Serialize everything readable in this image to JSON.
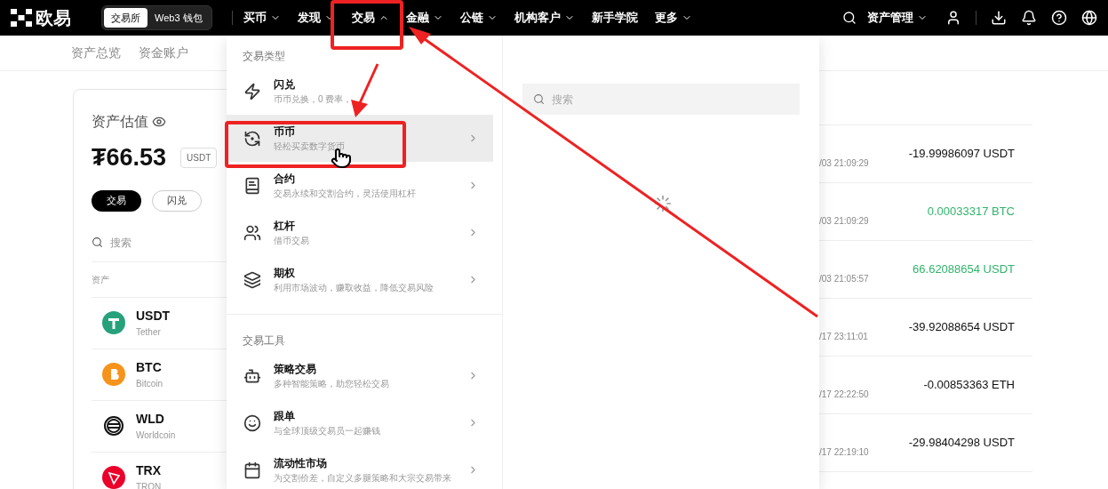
{
  "nav": {
    "logo": "欧易",
    "mode_switch": [
      {
        "label": "交易所",
        "selected": true
      },
      {
        "label": "Web3 钱包",
        "selected": false
      }
    ],
    "items": [
      {
        "label": "买币",
        "kind": "menu",
        "expanded": false
      },
      {
        "label": "发现",
        "kind": "menu",
        "expanded": false
      },
      {
        "label": "交易",
        "kind": "menu",
        "expanded": true
      },
      {
        "label": "金融",
        "kind": "menu",
        "expanded": false
      },
      {
        "label": "公链",
        "kind": "menu",
        "expanded": false
      },
      {
        "label": "机构客户",
        "kind": "menu",
        "expanded": false
      },
      {
        "label": "新手学院",
        "kind": "link"
      },
      {
        "label": "更多",
        "kind": "menu",
        "expanded": false
      }
    ],
    "asset_menu": "资产管理"
  },
  "sub_tabs": [
    "资产总览",
    "资金账户"
  ],
  "asset_card": {
    "title": "资产估值",
    "amount": "₮66.53",
    "currency": "USDT",
    "actions": [
      {
        "label": "交易",
        "selected": true
      },
      {
        "label": "闪兑",
        "selected": false
      }
    ],
    "search_placeholder": "搜索",
    "column": "资产",
    "assets": [
      {
        "symbol": "USDT",
        "name": "Tether",
        "color": "#26a17b"
      },
      {
        "symbol": "BTC",
        "name": "Bitcoin",
        "color": "#f7931a"
      },
      {
        "symbol": "WLD",
        "name": "Worldcoin",
        "color": "#111111"
      },
      {
        "symbol": "TRX",
        "name": "TRON",
        "color": "#eb0029"
      }
    ]
  },
  "records": [
    {
      "time": "/03 21:09:29",
      "amount": "-19.99986097 USDT",
      "kind": "out"
    },
    {
      "time": "/03 21:09:29",
      "amount": "0.00033317 BTC",
      "kind": "in"
    },
    {
      "time": "/03 21:05:57",
      "amount": "66.62088654 USDT",
      "kind": "in"
    },
    {
      "time": "/17 23:11:01",
      "amount": "-39.92088654 USDT",
      "kind": "out"
    },
    {
      "time": "/17 22:22:50",
      "amount": "-0.00853363 ETH",
      "kind": "out"
    },
    {
      "time": "/17 22:19:10",
      "amount": "-29.98404298 USDT",
      "kind": "out"
    }
  ],
  "dropdown": {
    "sections": [
      {
        "title": "交易类型",
        "items": [
          {
            "title": "闪兑",
            "desc": "币币兑换，0 费率，",
            "selected": false,
            "chevron": false
          },
          {
            "title": "币币",
            "desc": "轻松买卖数字货币",
            "selected": true,
            "chevron": true
          },
          {
            "title": "合约",
            "desc": "交易永续和交割合约，灵活使用杠杆",
            "selected": false,
            "chevron": true
          },
          {
            "title": "杠杆",
            "desc": "借币交易",
            "selected": false,
            "chevron": true
          },
          {
            "title": "期权",
            "desc": "利用市场波动，赚取收益，降低交易风险",
            "selected": false,
            "chevron": true
          }
        ]
      },
      {
        "title": "交易工具",
        "items": [
          {
            "title": "策略交易",
            "desc": "多种智能策略，助您轻松交易",
            "selected": false,
            "chevron": true
          },
          {
            "title": "跟单",
            "desc": "与全球顶级交易员一起赚钱",
            "selected": false,
            "chevron": true
          },
          {
            "title": "流动性市场",
            "desc": "为交割价差，自定义多腿策略和大宗交易带来",
            "selected": false,
            "chevron": true
          }
        ]
      }
    ],
    "search_placeholder": "搜索",
    "loading": true
  }
}
